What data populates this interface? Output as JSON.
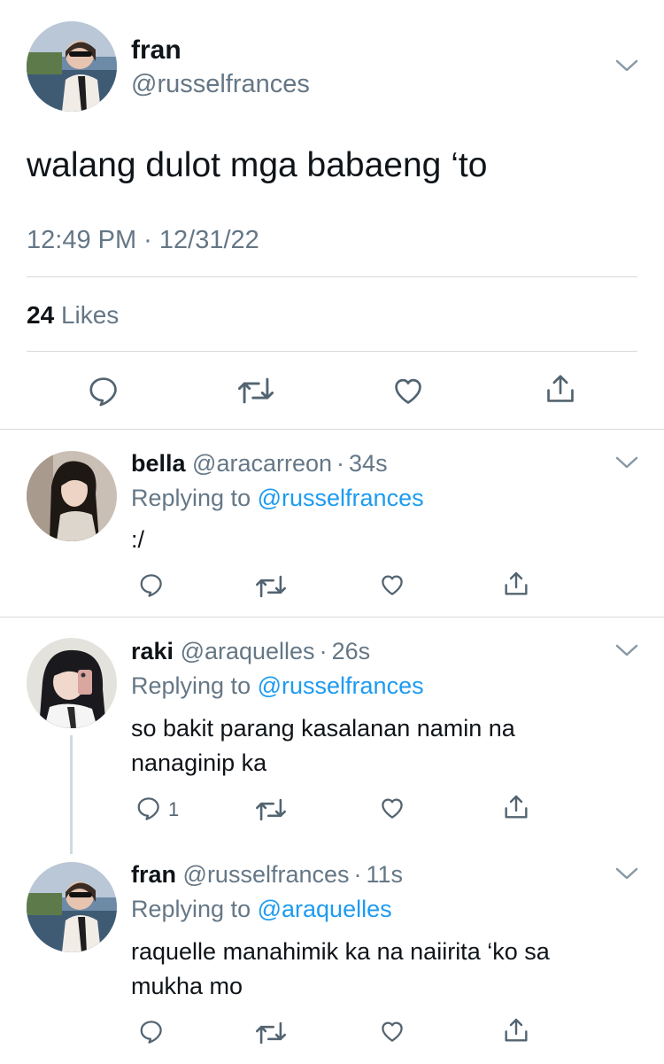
{
  "main_tweet": {
    "display_name": "fran",
    "handle": "@russelfrances",
    "text": "walang dulot mga babaeng ‘to",
    "timestamp": "12:49 PM · 12/31/22",
    "likes_count": "24",
    "likes_label": "Likes",
    "actions": [
      "reply-icon",
      "retweet-icon",
      "like-icon",
      "share-icon"
    ]
  },
  "replies": [
    {
      "display_name": "bella",
      "handle": "@aracarreon",
      "sep": "·",
      "age": "34s",
      "replying_prefix": "Replying to",
      "replying_to": "@russelfrances",
      "text": ":/"
    },
    {
      "display_name": "raki",
      "handle": "@araquelles",
      "sep": "·",
      "age": "26s",
      "replying_prefix": "Replying to",
      "replying_to": "@russelfrances",
      "text_line1": "so bakit parang kasalanan namin na",
      "text_line2": "nanaginip ka",
      "reply_count": "1"
    },
    {
      "display_name": "fran",
      "handle": "@russelfrances",
      "sep": "·",
      "age": "11s",
      "replying_prefix": "Replying to",
      "replying_to": "@araquelles",
      "text_line1": "raquelle manahimik ka na naiirita ‘ko sa",
      "text_line2": "mukha mo"
    }
  ],
  "colors": {
    "text": "#0f1419",
    "secondary": "#657786",
    "link": "#1d9bf0",
    "icon": "#536471",
    "divider": "#d9d9d9"
  }
}
